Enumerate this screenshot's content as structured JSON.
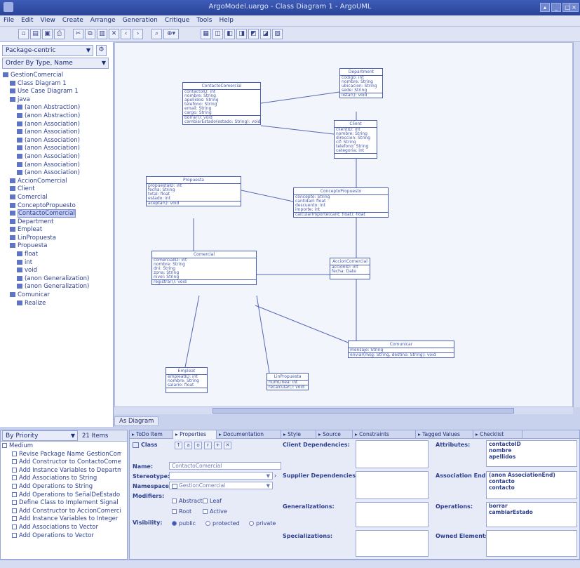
{
  "window": {
    "title": "ArgoModel.uargo - Class Diagram 1 - ArgoUML"
  },
  "menu": [
    "File",
    "Edit",
    "View",
    "Create",
    "Arrange",
    "Generation",
    "Critique",
    "Tools",
    "Help"
  ],
  "explorer": {
    "perspective": "Package-centric",
    "order": "Order By Type, Name",
    "tree": [
      "GestionComercial",
      "Class Diagram 1",
      "Use Case Diagram 1",
      "java",
      "(anon Abstraction)",
      "(anon Abstraction)",
      "(anon Association)",
      "(anon Association)",
      "(anon Association)",
      "(anon Association)",
      "(anon Association)",
      "(anon Association)",
      "(anon Association)",
      "AccionComercial",
      "Client",
      "Comercial",
      "ConceptoPropuesto",
      "ContactoComercial",
      "Department",
      "Empleat",
      "LinPropuesta",
      "Propuesta",
      "float",
      "int",
      "void",
      "(anon Generalization)",
      "(anon Generalization)",
      "Comunicar",
      "Realize"
    ]
  },
  "diagram": {
    "tab": "As Diagram",
    "classes": [
      {
        "name": "ContactoComercial",
        "attrs": [
          "contactoID: int",
          "nombre: String",
          "apellidos: String",
          "telefono: String",
          "email: String",
          "cargo: String"
        ],
        "ops": [
          "borrar(): void",
          "cambiarEstado(estado: String): void"
        ]
      },
      {
        "name": "Department",
        "attrs": [
          "codigo: int",
          "nombre: String",
          "ubicacion: String",
          "sede: String"
        ],
        "ops": [
          "listar(): void"
        ]
      },
      {
        "name": "Client",
        "attrs": [
          "clientID: int",
          "nombre: String",
          "direccion: String",
          "cif: String",
          "telefono: String",
          "categoria: int"
        ],
        "ops": []
      },
      {
        "name": "Propuesta",
        "attrs": [
          "propuestaID: int",
          "fecha: String",
          "total: float",
          "estado: int"
        ],
        "ops": [
          "aceptar(): void"
        ]
      },
      {
        "name": "ConceptoPropuesto",
        "attrs": [
          "concepto: String",
          "cantidad: float",
          "descuento: int",
          "importe: int"
        ],
        "ops": [
          "calcularImporte(cant: float): float"
        ]
      },
      {
        "name": "Comercial",
        "attrs": [
          "comercialID: int",
          "nombre: String",
          "dni: String",
          "zona: String",
          "nivel: String"
        ],
        "ops": [
          "registrar(): void"
        ]
      },
      {
        "name": "AccionComercial",
        "attrs": [
          "accionID: int",
          "fecha: Date"
        ],
        "ops": []
      },
      {
        "name": "Comunicar",
        "attrs": [
          "mensaje: String"
        ],
        "ops": [
          "enviar(msg: String, destino: String): void"
        ]
      },
      {
        "name": "Empleat",
        "attrs": [
          "empleatID: int",
          "nombre: String",
          "salario: float"
        ],
        "ops": []
      },
      {
        "name": "LinPropuesta",
        "attrs": [
          "numLinea: int"
        ],
        "ops": [
          "recalcular(): void"
        ]
      }
    ]
  },
  "todo": {
    "perspective": "By Priority",
    "count": "21 Items",
    "root": "Medium",
    "items": [
      "Revise Package Name GestionComercial",
      "Add Constructor to ContactoComercial",
      "Add Instance Variables to Department",
      "Add Associations to String",
      "Add Operations to String",
      "Add Operations to SeñalDeEstado",
      "Define Class to Implement Signal",
      "Add Constructor to AccionComercial",
      "Add Instance Variables to Integer",
      "Add Associations to Vector",
      "Add Operations to Vector"
    ]
  },
  "props": {
    "tabs": [
      "ToDo Item",
      "Properties",
      "Documentation",
      "Style",
      "Source",
      "Constraints",
      "Tagged Values",
      "Checklist"
    ],
    "element_type": "Class",
    "name_label": "Name:",
    "name_value": "ContactoComercial",
    "stereotype_label": "Stereotype:",
    "namespace_label": "Namespace:",
    "namespace_value": "GestionComercial",
    "modifiers_label": "Modifiers:",
    "mod_abstract": "Abstract",
    "mod_leaf": "Leaf",
    "mod_root": "Root",
    "mod_active": "Active",
    "visibility_label": "Visibility:",
    "vis_public": "public",
    "vis_protected": "protected",
    "vis_private": "private",
    "client_deps": "Client Dependencies:",
    "supplier_deps": "Supplier Dependencies:",
    "generalizations": "Generalizations:",
    "specializations": "Specializations:",
    "attributes_label": "Attributes:",
    "attributes": [
      "contactoID",
      "nombre",
      "apellidos"
    ],
    "assoc_ends_label": "Association Ends:",
    "assoc_ends": [
      "(anon AssociationEnd)",
      "contacto",
      "contacto"
    ],
    "operations_label": "Operations:",
    "operations": [
      "borrar",
      "cambiarEstado"
    ],
    "owned_label": "Owned Elements:"
  }
}
